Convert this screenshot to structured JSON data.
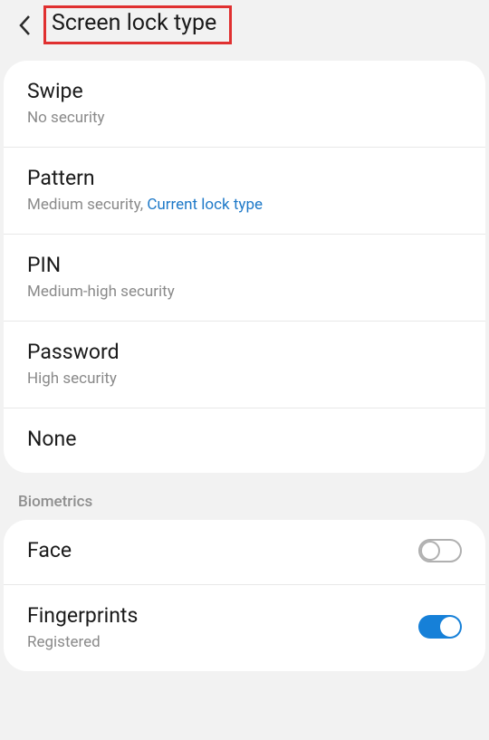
{
  "header": {
    "title": "Screen lock type"
  },
  "lockTypes": [
    {
      "title": "Swipe",
      "sub": "No security",
      "current": ""
    },
    {
      "title": "Pattern",
      "sub": "Medium security, ",
      "current": "Current lock type"
    },
    {
      "title": "PIN",
      "sub": "Medium-high security",
      "current": ""
    },
    {
      "title": "Password",
      "sub": "High security",
      "current": ""
    },
    {
      "title": "None",
      "sub": "",
      "current": ""
    }
  ],
  "sectionLabel": "Biometrics",
  "biometrics": {
    "face": {
      "title": "Face",
      "sub": "",
      "on": false
    },
    "fingerprints": {
      "title": "Fingerprints",
      "sub": "Registered",
      "on": true
    }
  }
}
